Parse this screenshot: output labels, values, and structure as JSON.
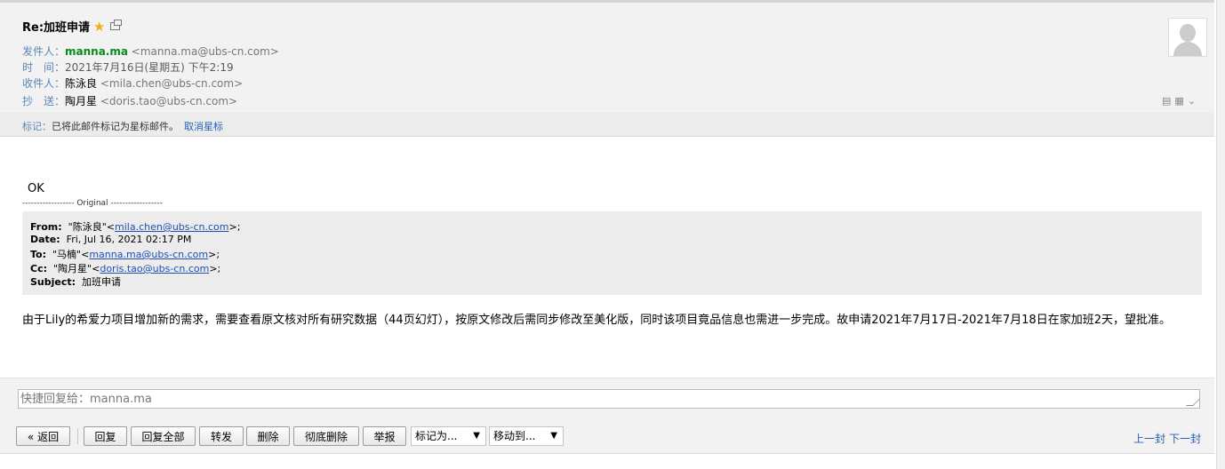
{
  "header": {
    "subject": "Re:加班申请",
    "from_label": "发件人：",
    "from_name": "manna.ma",
    "from_addr": "<manna.ma@ubs-cn.com>",
    "time_label": "时　间：",
    "time_value": "2021年7月16日(星期五) 下午2:19",
    "to_label": "收件人：",
    "to_name": "陈泳良",
    "to_addr": "<mila.chen@ubs-cn.com>",
    "cc_label": "抄　送：",
    "cc_name": "陶月星",
    "cc_addr": "<doris.tao@ubs-cn.com>"
  },
  "notice": {
    "label": "标记：",
    "text": "已将此邮件标记为星标邮件。",
    "link": "取消星标"
  },
  "body": {
    "reply_text": "OK",
    "original_sep": "------------------ Original ------------------",
    "quote": {
      "from_label": "From:",
      "from_name": "\"陈泳良\"<",
      "from_addr": "mila.chen@ubs-cn.com",
      "from_end": ">;",
      "date_label": "Date:",
      "date_value": "Fri, Jul 16, 2021 02:17 PM",
      "to_label": "To:",
      "to_name": "\"马楠\"<",
      "to_addr": "manna.ma@ubs-cn.com",
      "to_end": ">;",
      "cc_label": "Cc:",
      "cc_name": "\"陶月星\"<",
      "cc_addr": "doris.tao@ubs-cn.com",
      "cc_end": ">;",
      "subject_label": "Subject:",
      "subject_value": "加班申请"
    },
    "message": "由于Lily的希爱力项目增加新的需求，需要查看原文核对所有研究数据（44页幻灯），按原文修改后需同步修改至美化版，同时该项目竟品信息也需进一步完成。故申请2021年7月17日-2021年7月18日在家加班2天，望批准。"
  },
  "quick_reply": {
    "placeholder": "快捷回复给：manna.ma"
  },
  "toolbar": {
    "back": "« 返回",
    "reply": "回复",
    "reply_all": "回复全部",
    "forward": "转发",
    "delete": "删除",
    "delete_forever": "彻底删除",
    "report": "举报",
    "mark_as": "标记为...",
    "move_to": "移动到...",
    "prev": "上一封",
    "next": "下一封"
  },
  "colors": {
    "accent_link": "#2a62b6",
    "sender_green": "#0b8a1d",
    "star": "#f2b111"
  }
}
